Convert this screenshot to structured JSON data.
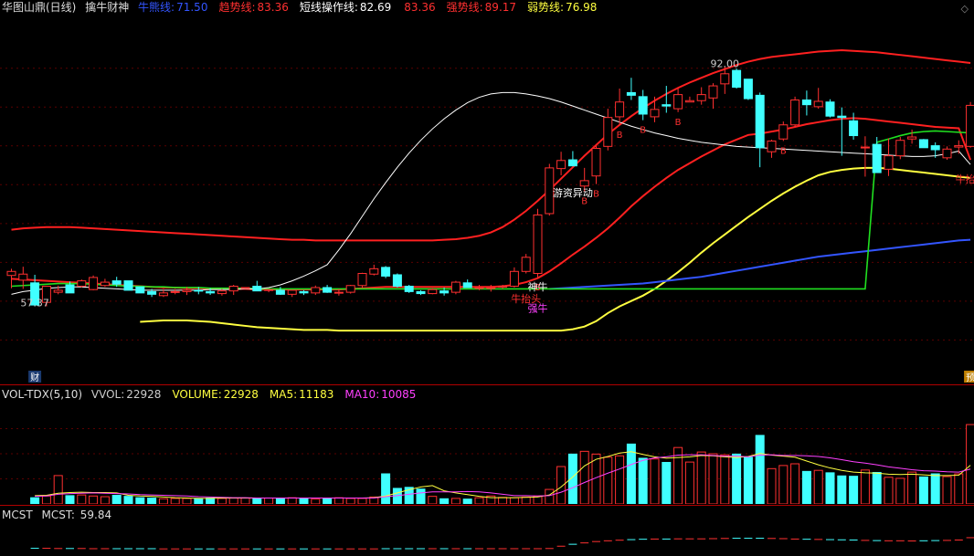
{
  "header": {
    "security": "华图山鼎(日线)",
    "indicator": "擒牛财神",
    "items": [
      {
        "label": "牛熊线:",
        "value": "71.50",
        "color": "#3355ff"
      },
      {
        "label": "趋势线:",
        "value": "83.36",
        "color": "#ff3030"
      },
      {
        "label": "短线操作线:",
        "value": "82.69",
        "color": "#ffffff"
      },
      {
        "label": "",
        "value": "83.36",
        "color": "#ff3030"
      },
      {
        "label": "强势线:",
        "value": "89.17",
        "color": "#ff3030"
      },
      {
        "label": "弱势线:",
        "value": "76.98",
        "color": "#ffff40"
      }
    ]
  },
  "vol_header": {
    "name": "VOL-TDX(5,10)",
    "items": [
      {
        "label": "VVOL:",
        "value": "22928",
        "color": "#cccccc"
      },
      {
        "label": "VOLUME:",
        "value": "22928",
        "color": "#ffff40"
      },
      {
        "label": "MA5:",
        "value": "11183",
        "color": "#ffff40"
      },
      {
        "label": "MA10:",
        "value": "10085",
        "color": "#ff40ff"
      }
    ]
  },
  "mcst_header": {
    "name": "MCST",
    "label": "MCST:",
    "value": "59.84"
  },
  "colors": {
    "up": "#ff3030",
    "down": "#40ffff",
    "bull": "#ff3030",
    "bear": "#3355ff",
    "trend": "#ff2020",
    "weak": "#ffff40",
    "short": "#ffffff",
    "green": "#20e020",
    "ma10": "#ff40ff"
  },
  "chart_data": {
    "type": "candlestick",
    "ylim": [
      50,
      105
    ],
    "candles": [
      [
        66.2,
        67.2,
        64.3,
        66.8
      ],
      [
        65.5,
        67.5,
        64.2,
        66.4
      ],
      [
        65.1,
        66.3,
        61.6,
        61.8
      ],
      [
        62.2,
        64.6,
        61.6,
        64.6
      ],
      [
        63.7,
        64.7,
        63.4,
        64.0
      ],
      [
        64.8,
        65.3,
        63.6,
        63.6
      ],
      [
        64.6,
        65.6,
        64.4,
        65.4
      ],
      [
        64.1,
        66.2,
        64.0,
        65.9
      ],
      [
        64.7,
        65.7,
        64.5,
        65.2
      ],
      [
        65.4,
        66.0,
        64.5,
        64.9
      ],
      [
        65.4,
        65.4,
        64.0,
        64.0
      ],
      [
        64.5,
        64.5,
        63.6,
        63.6
      ],
      [
        63.8,
        64.2,
        63.0,
        63.4
      ],
      [
        63.2,
        64.2,
        63.0,
        63.6
      ],
      [
        63.7,
        64.2,
        63.4,
        63.8
      ],
      [
        63.8,
        64.5,
        63.3,
        64.0
      ],
      [
        64.0,
        64.5,
        63.4,
        63.9
      ],
      [
        63.8,
        64.3,
        63.3,
        63.6
      ],
      [
        63.5,
        64.2,
        63.2,
        63.9
      ],
      [
        63.9,
        64.8,
        63.3,
        64.6
      ],
      [
        64.4,
        64.4,
        64.4,
        64.4
      ],
      [
        64.6,
        65.4,
        64.3,
        63.9
      ],
      [
        64.0,
        64.1,
        63.7,
        64.1
      ],
      [
        64.0,
        64.5,
        63.3,
        63.4
      ],
      [
        63.4,
        64.0,
        63.0,
        64.0
      ],
      [
        63.8,
        64.0,
        63.3,
        63.6
      ],
      [
        63.6,
        64.7,
        63.3,
        64.4
      ],
      [
        64.4,
        64.8,
        63.6,
        63.7
      ],
      [
        63.6,
        64.2,
        63.2,
        63.7
      ],
      [
        63.7,
        64.8,
        63.5,
        64.7
      ],
      [
        64.7,
        66.6,
        64.4,
        66.5
      ],
      [
        66.4,
        67.8,
        66.2,
        67.2
      ],
      [
        67.4,
        67.6,
        65.8,
        66.1
      ],
      [
        66.3,
        66.5,
        64.4,
        64.6
      ],
      [
        64.6,
        64.8,
        63.6,
        63.8
      ],
      [
        63.8,
        64.0,
        63.3,
        63.5
      ],
      [
        63.5,
        64.3,
        63.4,
        64.1
      ],
      [
        63.9,
        64.4,
        63.2,
        63.6
      ],
      [
        63.7,
        65.4,
        63.4,
        65.2
      ],
      [
        65.1,
        65.6,
        64.4,
        64.4
      ],
      [
        64.4,
        64.8,
        64.0,
        64.4
      ],
      [
        64.3,
        64.8,
        63.8,
        64.4
      ],
      [
        64.5,
        64.8,
        64.2,
        64.6
      ],
      [
        64.6,
        67.4,
        64.4,
        66.8
      ],
      [
        66.8,
        69.4,
        66.5,
        68.9
      ],
      [
        66.5,
        76.1,
        65.9,
        75.2
      ],
      [
        75.4,
        82.8,
        75.1,
        82.2
      ],
      [
        82.1,
        84.6,
        81.1,
        83.3
      ],
      [
        83.4,
        84.7,
        82.5,
        82.5
      ],
      [
        79.5,
        82.2,
        78.7,
        80.3
      ],
      [
        81.0,
        85.5,
        79.8,
        85.1
      ],
      [
        85.4,
        91.0,
        84.8,
        89.7
      ],
      [
        89.8,
        94.0,
        88.6,
        92.0
      ],
      [
        93.4,
        95.6,
        92.3,
        93.0
      ],
      [
        92.8,
        93.8,
        89.3,
        90.2
      ],
      [
        89.8,
        92.8,
        89.0,
        90.9
      ],
      [
        91.6,
        94.4,
        90.4,
        91.4
      ],
      [
        91.0,
        94.0,
        90.5,
        93.1
      ],
      [
        92.0,
        92.8,
        92.0,
        92.2
      ],
      [
        92.2,
        94.2,
        91.6,
        93.1
      ],
      [
        92.6,
        94.8,
        91.0,
        94.4
      ],
      [
        94.7,
        97.2,
        93.2,
        96.2
      ],
      [
        96.7,
        97.0,
        94.0,
        94.2
      ],
      [
        95.4,
        95.4,
        92.3,
        92.5
      ],
      [
        93.0,
        93.4,
        82.3,
        85.2
      ],
      [
        84.6,
        86.4,
        83.7,
        86.2
      ],
      [
        86.5,
        89.1,
        86.2,
        88.6
      ],
      [
        88.6,
        92.8,
        88.3,
        92.3
      ],
      [
        92.3,
        93.7,
        90.0,
        91.6
      ],
      [
        91.3,
        94.1,
        91.0,
        92.1
      ],
      [
        92.0,
        92.4,
        89.7,
        89.9
      ],
      [
        89.9,
        91.2,
        84.0,
        89.7
      ],
      [
        89.2,
        90.4,
        86.4,
        87.0
      ],
      [
        85.3,
        86.9,
        80.9,
        85.3
      ],
      [
        85.7,
        86.8,
        83.8,
        81.5
      ],
      [
        82.0,
        86.6,
        81.0,
        84.0
      ],
      [
        84.0,
        86.8,
        83.5,
        86.3
      ],
      [
        86.5,
        87.9,
        85.8,
        86.8
      ],
      [
        86.4,
        86.5,
        85.6,
        85.2
      ],
      [
        85.5,
        86.0,
        83.7,
        84.9
      ],
      [
        83.7,
        85.4,
        83.4,
        85.0
      ],
      [
        85.3,
        86.3,
        84.3,
        85.5
      ],
      [
        85.4,
        92.0,
        85.2,
        91.5
      ]
    ],
    "lines": {
      "trend": [
        65.7,
        65.6,
        65.5,
        65.4,
        65.3,
        65.2,
        65.1,
        65.0,
        64.9,
        64.8,
        64.7,
        64.6,
        64.5,
        64.4,
        64.4,
        64.3,
        64.3,
        64.2,
        64.2,
        64.2,
        64.2,
        64.1,
        64.1,
        64.1,
        64.1,
        64.1,
        64.1,
        64.1,
        64.1,
        64.2,
        64.3,
        64.4,
        64.5,
        64.5,
        64.5,
        64.5,
        64.5,
        64.5,
        64.5,
        64.5,
        64.5,
        64.5,
        64.6,
        64.8,
        65.2,
        65.8,
        66.8,
        68.0,
        69.3,
        70.5,
        71.8,
        73.2,
        74.8,
        76.5,
        78.0,
        79.4,
        80.7,
        81.9,
        82.9,
        83.9,
        84.8,
        85.7,
        86.4,
        87.1,
        87.3,
        87.6,
        87.9,
        88.3,
        88.7,
        89.0,
        89.3,
        89.5,
        89.6,
        89.5,
        89.3,
        89.1,
        88.9,
        88.7,
        88.5,
        88.3,
        88.2,
        88.1,
        83.4
      ],
      "strong": [
        73.0,
        73.2,
        73.3,
        73.4,
        73.4,
        73.4,
        73.3,
        73.2,
        73.1,
        73.0,
        72.9,
        72.8,
        72.7,
        72.6,
        72.5,
        72.4,
        72.3,
        72.2,
        72.1,
        72.0,
        71.9,
        71.8,
        71.7,
        71.6,
        71.5,
        71.5,
        71.4,
        71.4,
        71.4,
        71.4,
        71.4,
        71.4,
        71.4,
        71.4,
        71.4,
        71.4,
        71.4,
        71.5,
        71.6,
        71.8,
        72.1,
        72.6,
        73.4,
        74.5,
        75.8,
        77.3,
        78.9,
        80.6,
        82.3,
        84.0,
        85.6,
        87.2,
        88.6,
        89.9,
        91.1,
        92.2,
        93.2,
        94.1,
        94.9,
        95.6,
        96.3,
        96.9,
        97.5,
        98.0,
        98.4,
        98.7,
        98.9,
        99.1,
        99.3,
        99.5,
        99.6,
        99.7,
        99.6,
        99.5,
        99.4,
        99.2,
        99.0,
        98.8,
        98.6,
        98.4,
        98.2,
        98.0,
        97.8
      ],
      "weak": [
        59.3,
        59.4,
        59.5,
        59.5,
        59.5,
        59.4,
        59.3,
        59.1,
        58.9,
        58.7,
        58.5,
        58.4,
        58.3,
        58.2,
        58.1,
        58.1,
        58.1,
        58.0,
        58.0,
        58.0,
        58.0,
        58.0,
        58.0,
        58.0,
        58.0,
        58.0,
        58.0,
        58.0,
        58.0,
        58.0,
        58.0,
        58.0,
        58.0,
        58.0,
        58.0,
        58.0,
        58.0,
        58.2,
        58.6,
        59.4,
        60.6,
        61.6,
        62.4,
        63.2,
        64.2,
        65.4,
        66.7,
        68.1,
        69.6,
        71.0,
        72.3,
        73.6,
        74.9,
        76.1,
        77.3,
        78.4,
        79.4,
        80.3,
        81.1,
        81.6,
        81.9,
        82.1,
        82.2,
        82.2,
        82.1,
        81.9,
        81.7,
        81.5,
        81.3,
        81.1,
        80.9,
        80.7
      ],
      "bear": [
        64.2,
        64.3,
        64.4,
        64.5,
        64.6,
        64.7,
        64.8,
        64.9,
        65.0,
        65.2,
        65.4,
        65.6,
        65.8,
        66.0,
        66.3,
        66.6,
        66.9,
        67.2,
        67.5,
        67.8,
        68.1,
        68.4,
        68.7,
        69.0,
        69.2,
        69.4,
        69.6,
        69.8,
        70.0,
        70.2,
        70.4,
        70.6,
        70.8,
        71.0,
        71.2,
        71.4,
        71.5
      ],
      "short": [
        63.4,
        63.8,
        64.0,
        64.3,
        64.4,
        64.5,
        64.5,
        64.4,
        64.3,
        64.2,
        64.1,
        64.0,
        64.0,
        64.0,
        64.0,
        64.0,
        64.0,
        64.1,
        64.1,
        64.1,
        64.2,
        64.2,
        64.4,
        64.8,
        65.4,
        66.1,
        66.9,
        67.8,
        70.0,
        72.4,
        75.0,
        77.6,
        80.0,
        82.3,
        84.4,
        86.3,
        88.0,
        89.5,
        90.8,
        91.9,
        92.7,
        93.2,
        93.4,
        93.4,
        93.2,
        92.9,
        92.5,
        92.0,
        91.4,
        90.8,
        90.2,
        89.6,
        89.0,
        88.4,
        87.9,
        87.4,
        87.0,
        86.6,
        86.3,
        86.0,
        85.8,
        85.6,
        85.4,
        85.3,
        85.2,
        85.1,
        85.0,
        84.9,
        84.8,
        84.7,
        84.6,
        84.5,
        84.4,
        84.3,
        84.2,
        84.1,
        84.0,
        83.9,
        83.9,
        84.0,
        84.3,
        84.7,
        82.7
      ],
      "green": [
        64.6,
        64.7,
        64.8,
        64.9,
        65.0,
        65.0,
        65.0,
        64.9,
        64.8,
        64.7,
        64.6,
        64.6,
        64.5,
        64.5,
        64.4,
        64.4,
        64.4,
        64.3,
        64.3,
        64.3,
        64.3,
        64.2,
        64.2,
        64.2,
        64.2,
        64.2,
        64.2,
        64.2,
        64.2,
        64.2,
        64.2,
        64.2,
        64.2,
        64.2,
        64.2,
        64.2,
        64.2,
        64.2,
        64.2,
        64.2,
        64.2,
        64.2,
        64.2,
        64.2,
        64.2,
        64.2,
        64.2,
        64.2,
        64.2,
        64.2,
        64.2,
        64.2,
        64.2,
        64.2,
        64.2,
        64.2,
        64.2,
        64.2,
        64.2,
        64.2,
        64.2,
        64.2,
        64.2,
        64.2,
        64.2,
        64.2,
        64.2,
        64.2,
        64.2,
        64.2,
        64.2,
        64.2,
        64.2,
        64.2,
        86.0,
        86.5,
        87.0,
        87.4,
        87.6,
        87.7,
        87.6,
        87.5,
        87.4
      ]
    },
    "annotations": [
      {
        "text": "57.37",
        "index": 2,
        "price": 61.6,
        "color": "#cccccc"
      },
      {
        "text": "92.00",
        "index": 61,
        "price": 97.2,
        "color": "#cccccc"
      },
      {
        "text": "游资异动",
        "index": 48,
        "price": 78.0,
        "color": "#ffffff"
      },
      {
        "text": "神牛",
        "index": 45,
        "price": 64.0,
        "color": "#ffffff"
      },
      {
        "text": "牛抬头",
        "index": 44,
        "price": 62.2,
        "color": "#ff3030"
      },
      {
        "text": "强牛",
        "index": 45,
        "price": 60.8,
        "color": "#ff40ff"
      },
      {
        "text": "牛抬头",
        "index": 82,
        "price": 80.0,
        "color": "#ff3030"
      }
    ],
    "b_marks": [
      45,
      49,
      50,
      52,
      54,
      57,
      66
    ],
    "bottom_tags": [
      {
        "text": "财",
        "index": 2
      },
      {
        "text": "预",
        "index": 82
      }
    ],
    "volume": {
      "ylim": [
        0,
        29000
      ],
      "values": [
        1800,
        2300,
        8200,
        2400,
        2600,
        2300,
        2100,
        2500,
        2200,
        1800,
        1700,
        1500,
        1600,
        1600,
        1600,
        1700,
        1600,
        1700,
        1700,
        1700,
        1700,
        1600,
        1800,
        1500,
        1400,
        1700,
        1800,
        1600,
        1600,
        2000,
        8700,
        4500,
        4800,
        4300,
        2200,
        1500,
        1600,
        1400,
        1800,
        2300,
        1900,
        1800,
        2000,
        2300,
        4200,
        10800,
        14400,
        15200,
        14400,
        13500,
        13900,
        17300,
        13200,
        13000,
        12000,
        16300,
        12100,
        15000,
        14500,
        14200,
        14400,
        13500,
        19800,
        10200,
        11100,
        11600,
        9400,
        9700,
        9000,
        8100,
        8000,
        9800,
        9100,
        7700,
        7400,
        9200,
        7800,
        8700,
        7900,
        8700,
        22928
      ]
    },
    "vol_ma5": [
      2400,
      2500,
      3100,
      3300,
      3400,
      3300,
      3300,
      3200,
      2500,
      2300,
      2200,
      2000,
      1800,
      1700,
      1600,
      1600,
      1700,
      1700,
      1700,
      1700,
      1700,
      1700,
      1700,
      1700,
      1700,
      1700,
      1700,
      1700,
      1700,
      1800,
      2300,
      3200,
      4100,
      4900,
      5300,
      3800,
      3200,
      2700,
      2200,
      1800,
      1800,
      1800,
      1900,
      2000,
      2600,
      4900,
      7800,
      11000,
      12900,
      13700,
      14700,
      15100,
      14300,
      13600,
      13200,
      13400,
      13600,
      14000,
      13900,
      13600,
      13400,
      13700,
      14600,
      14100,
      13800,
      13500,
      12400,
      11300,
      10400,
      9700,
      9200,
      9000,
      8900,
      8600,
      8500,
      8600,
      8400,
      8200,
      8200,
      8300,
      11183
    ],
    "vol_ma10": [
      2200,
      2300,
      2800,
      3000,
      3100,
      3200,
      3100,
      3000,
      2900,
      2700,
      2600,
      2500,
      2400,
      2300,
      2100,
      2000,
      1900,
      1800,
      1800,
      1700,
      1700,
      1700,
      1700,
      1700,
      1700,
      1700,
      1700,
      1700,
      1700,
      1700,
      2100,
      2400,
      2800,
      3200,
      3500,
      3500,
      3500,
      3600,
      3500,
      3200,
      2800,
      2400,
      2400,
      2300,
      2400,
      3400,
      4700,
      6200,
      7600,
      8900,
      10100,
      11400,
      12600,
      13300,
      13600,
      14100,
      14200,
      14200,
      14000,
      13800,
      13800,
      13600,
      14100,
      14200,
      14000,
      14000,
      13900,
      13700,
      13300,
      12800,
      12200,
      11800,
      11300,
      10700,
      10300,
      9900,
      9600,
      9500,
      9300,
      9200,
      10085
    ],
    "mcst": {
      "ylim": [
        55,
        72
      ],
      "values": [
        58.5,
        58.5,
        58.4,
        58.4,
        58.4,
        58.3,
        58.3,
        58.3,
        58.3,
        58.3,
        58.3,
        58.2,
        58.2,
        58.2,
        58.2,
        58.2,
        58.2,
        58.2,
        58.2,
        58.2,
        58.2,
        58.2,
        58.2,
        58.2,
        58.2,
        58.2,
        58.2,
        58.2,
        58.2,
        58.2,
        58.3,
        58.3,
        58.3,
        58.3,
        58.3,
        58.3,
        58.3,
        58.3,
        58.3,
        58.3,
        58.3,
        58.3,
        58.3,
        58.3,
        58.4,
        59.6,
        60.6,
        61.3,
        62.0,
        62.4,
        62.7,
        63.0,
        63.2,
        63.3,
        63.3,
        63.4,
        63.4,
        63.4,
        63.5,
        63.6,
        63.7,
        63.7,
        63.7,
        63.6,
        63.5,
        63.3,
        63.2,
        63.1,
        63.0,
        62.9,
        62.8,
        62.6,
        62.5,
        62.4,
        62.4,
        62.3,
        62.4,
        62.5,
        62.6,
        62.8,
        64.0
      ]
    }
  }
}
